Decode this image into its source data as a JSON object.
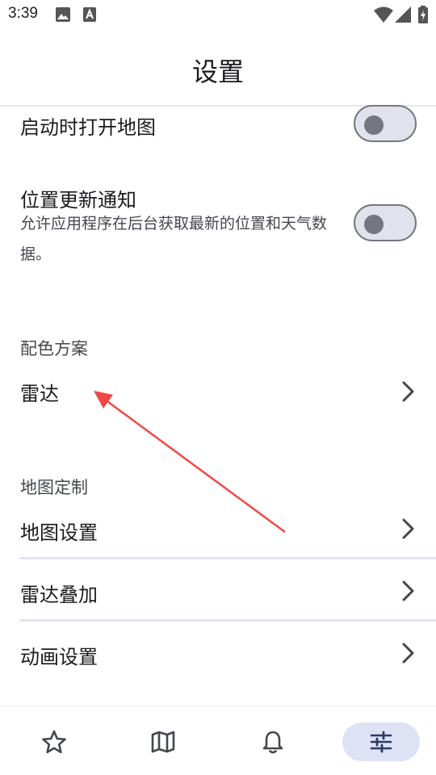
{
  "status_bar": {
    "time": "3:39",
    "left_icons": [
      "image-notification-icon",
      "a-notification-icon"
    ],
    "right_icons": [
      "wifi-icon",
      "cellular-signal-icon",
      "battery-charging-icon"
    ]
  },
  "app_bar": {
    "title": "设置"
  },
  "settings": {
    "open_map_on_launch": {
      "label": "启动时打开地图",
      "enabled": false
    },
    "location_update_notification": {
      "label": "位置更新通知",
      "description": "允许应用程序在后台获取最新的位置和天气数据。",
      "enabled": false
    },
    "color_scheme": {
      "section_title": "配色方案",
      "item_label": "雷达"
    },
    "map_customization": {
      "section_title": "地图定制",
      "items": [
        {
          "label": "地图设置"
        },
        {
          "label": "雷达叠加"
        },
        {
          "label": "动画设置"
        }
      ]
    }
  },
  "bottom_nav": {
    "items": [
      {
        "icon": "star-icon",
        "active": false
      },
      {
        "icon": "map-icon",
        "active": false
      },
      {
        "icon": "bell-icon",
        "active": false
      },
      {
        "icon": "sliders-icon",
        "active": true
      }
    ]
  },
  "colors": {
    "annotation_arrow": "#f04848",
    "active_nav_bg": "#dde3f5",
    "toggle_outline": "#74777f"
  }
}
